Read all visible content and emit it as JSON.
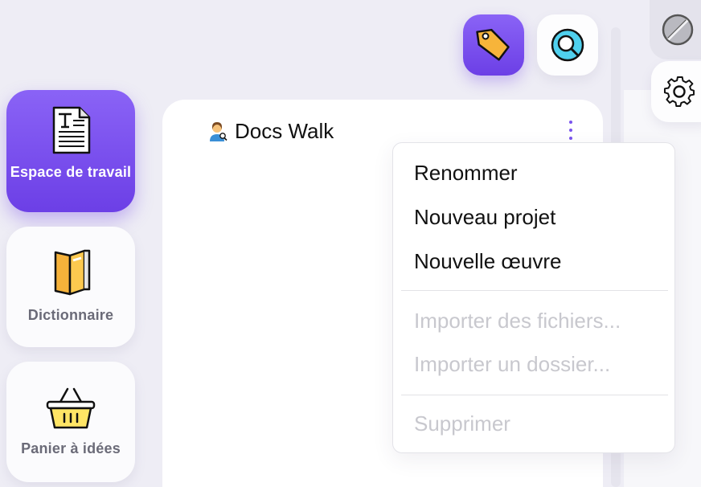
{
  "nav": {
    "items": [
      {
        "label": "Espace de travail",
        "icon": "document-icon",
        "active": true
      },
      {
        "label": "Dictionnaire",
        "icon": "book-icon",
        "active": false
      },
      {
        "label": "Panier à idées",
        "icon": "basket-icon",
        "active": false
      }
    ]
  },
  "toolbar": {
    "tag_icon": "tag-icon",
    "search_icon": "search-icon",
    "disabled_icon": "disabled-icon",
    "settings_icon": "gear-icon"
  },
  "document": {
    "emoji": "person-with-lupe-emoji",
    "title": "Docs Walk"
  },
  "context_menu": {
    "items": [
      {
        "label": "Renommer",
        "enabled": true
      },
      {
        "label": "Nouveau projet",
        "enabled": true
      },
      {
        "label": "Nouvelle œuvre",
        "enabled": true
      },
      {
        "label": "Importer des fichiers...",
        "enabled": false
      },
      {
        "label": "Importer un dossier...",
        "enabled": false
      },
      {
        "label": "Supprimer",
        "enabled": false
      }
    ]
  },
  "colors": {
    "accent": "#7a55ee",
    "background": "#eeedf5",
    "disabled_text": "#c8c8ce"
  }
}
